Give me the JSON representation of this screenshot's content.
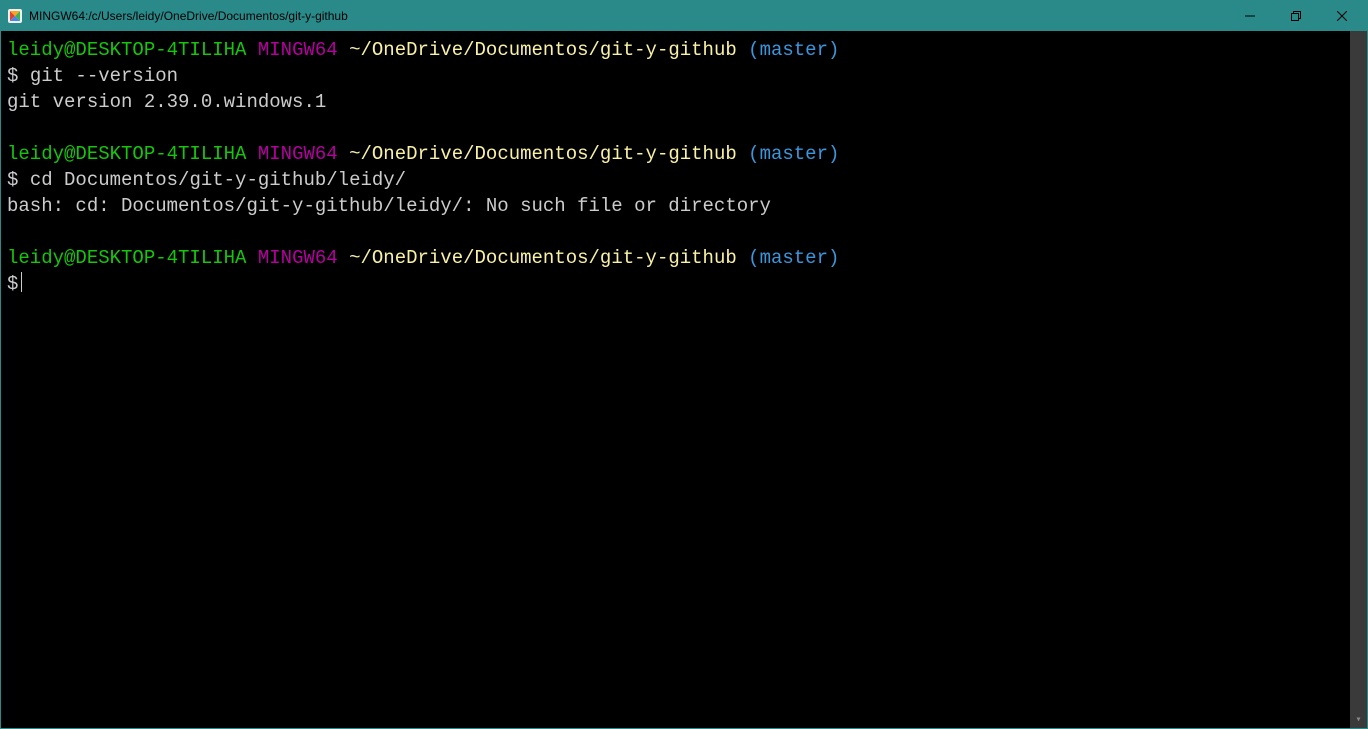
{
  "window": {
    "title": "MINGW64:/c/Users/leidy/OneDrive/Documentos/git-y-github"
  },
  "colors": {
    "titlebar_bg": "#2a8a8a",
    "terminal_bg": "#000000",
    "green": "#16c60c",
    "purple": "#b4009e",
    "yellow": "#f9f1a5",
    "cyan": "#3a96dd",
    "text": "#cccccc"
  },
  "prompt": {
    "user_host": "leidy@DESKTOP-4TILIHA",
    "shell": "MINGW64",
    "path": "~/OneDrive/Documentos/git-y-github",
    "branch": "(master)",
    "symbol": "$"
  },
  "blocks": [
    {
      "command": "git --version",
      "output": [
        "git version 2.39.0.windows.1"
      ]
    },
    {
      "command": "cd Documentos/git-y-github/leidy/",
      "output": [
        "bash: cd: Documentos/git-y-github/leidy/: No such file or directory"
      ]
    },
    {
      "command": "",
      "output": []
    }
  ]
}
